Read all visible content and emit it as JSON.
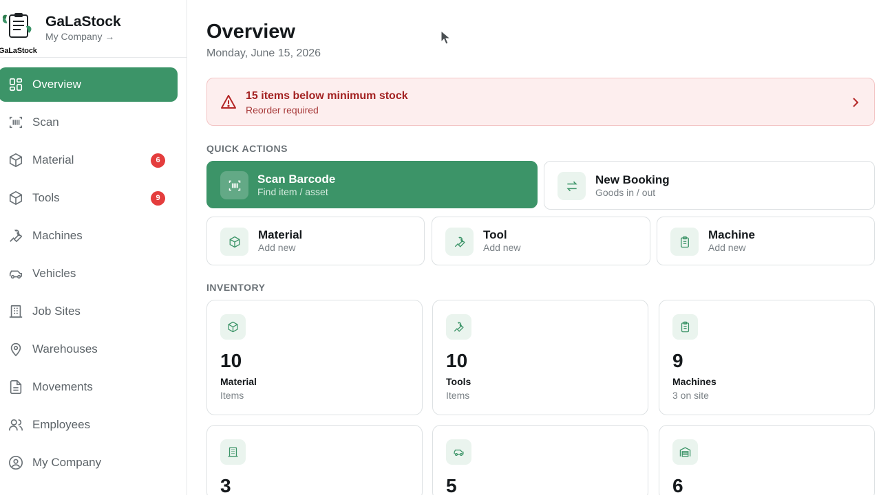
{
  "brand": {
    "name": "GaLaStock",
    "logo_text": "GaLaStock",
    "company_link": "My Company →"
  },
  "nav": {
    "items": [
      {
        "label": "Overview",
        "icon": "grid-icon",
        "active": true
      },
      {
        "label": "Scan",
        "icon": "barcode-scan-icon"
      },
      {
        "label": "Material",
        "icon": "box-icon",
        "badge": "6"
      },
      {
        "label": "Tools",
        "icon": "box-icon",
        "badge": "9"
      },
      {
        "label": "Machines",
        "icon": "wrench-icon"
      },
      {
        "label": "Vehicles",
        "icon": "car-icon"
      },
      {
        "label": "Job Sites",
        "icon": "building-icon"
      },
      {
        "label": "Warehouses",
        "icon": "map-pin-icon"
      },
      {
        "label": "Movements",
        "icon": "document-icon"
      },
      {
        "label": "Employees",
        "icon": "users-icon"
      },
      {
        "label": "My Company",
        "icon": "user-circle-icon"
      }
    ]
  },
  "header": {
    "title": "Overview",
    "date": "Monday, June 15, 2026"
  },
  "alert": {
    "title": "15 items below minimum stock",
    "subtitle": "Reorder required"
  },
  "quick_actions": {
    "label": "QUICK ACTIONS",
    "scan": {
      "title": "Scan Barcode",
      "subtitle": "Find item / asset"
    },
    "booking": {
      "title": "New Booking",
      "subtitle": "Goods in / out"
    },
    "material": {
      "title": "Material",
      "subtitle": "Add new"
    },
    "tool": {
      "title": "Tool",
      "subtitle": "Add new"
    },
    "machine": {
      "title": "Machine",
      "subtitle": "Add new"
    }
  },
  "inventory": {
    "label": "INVENTORY",
    "cards": [
      {
        "value": "10",
        "title": "Material",
        "subtitle": "Items",
        "icon": "box-icon"
      },
      {
        "value": "10",
        "title": "Tools",
        "subtitle": "Items",
        "icon": "wrench-icon"
      },
      {
        "value": "9",
        "title": "Machines",
        "subtitle": "3 on site",
        "icon": "clipboard-icon"
      },
      {
        "value": "3",
        "icon": "building-icon"
      },
      {
        "value": "5",
        "icon": "car-icon"
      },
      {
        "value": "6",
        "icon": "warehouse-icon"
      }
    ]
  },
  "colors": {
    "accent": "#3c9468",
    "alert_bg": "#fdeeee",
    "alert_text": "#a32222",
    "badge": "#e43d3d"
  }
}
